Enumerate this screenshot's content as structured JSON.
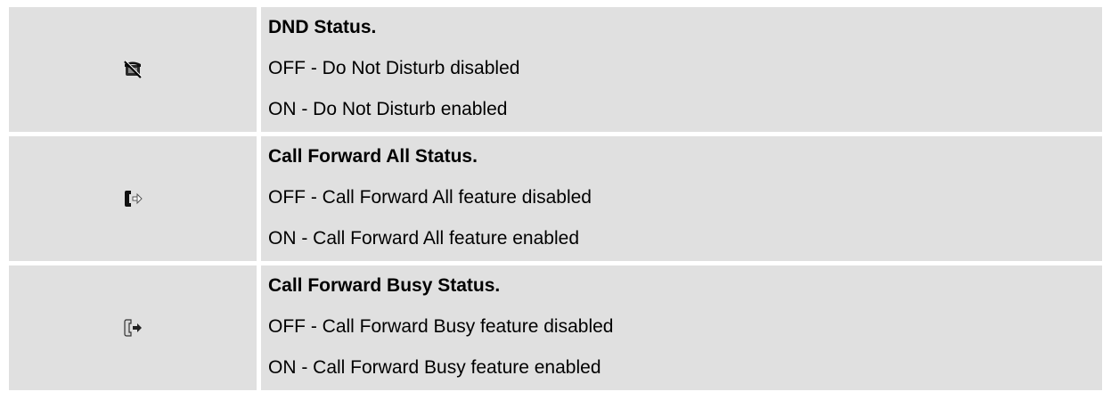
{
  "rows": [
    {
      "icon": "dnd-icon",
      "title": "DND Status.",
      "off": "OFF - Do Not Disturb disabled",
      "on": "ON - Do Not Disturb enabled"
    },
    {
      "icon": "call-forward-all-icon",
      "title": "Call Forward All Status.",
      "off": "OFF - Call Forward All feature disabled",
      "on": "ON - Call Forward All feature enabled"
    },
    {
      "icon": "call-forward-busy-icon",
      "title": "Call Forward Busy Status.",
      "off": "OFF - Call Forward Busy feature disabled",
      "on": "ON - Call Forward Busy feature enabled"
    }
  ],
  "colors": {
    "cell_background": "#e0e0e0",
    "page_background": "#ffffff"
  }
}
